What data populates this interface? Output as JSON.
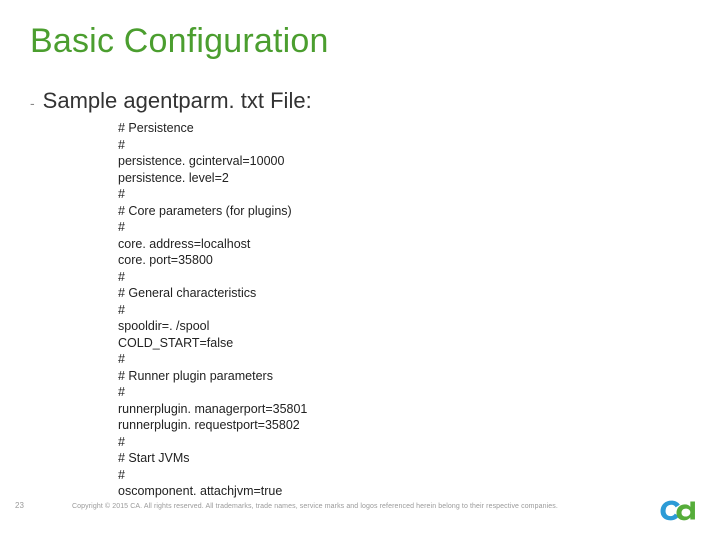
{
  "title": "Basic Configuration",
  "subtitle": "Sample agentparm. txt File:",
  "file_lines": [
    "# Persistence",
    "#",
    "persistence. gcinterval=10000",
    "persistence. level=2",
    "#",
    "# Core parameters (for plugins)",
    "#",
    "core. address=localhost",
    "core. port=35800",
    "#",
    "# General characteristics",
    "#",
    "spooldir=. /spool",
    "COLD_START=false",
    "#",
    "# Runner plugin parameters",
    "#",
    "runnerplugin. managerport=35801",
    "runnerplugin. requestport=35802",
    "#",
    "# Start JVMs",
    "#",
    "oscomponent. attachjvm=true"
  ],
  "page_number": "23",
  "copyright": "Copyright © 2015 CA. All rights reserved. All trademarks, trade names, service marks and logos referenced herein belong to their respective companies.",
  "logo_name": "ca"
}
